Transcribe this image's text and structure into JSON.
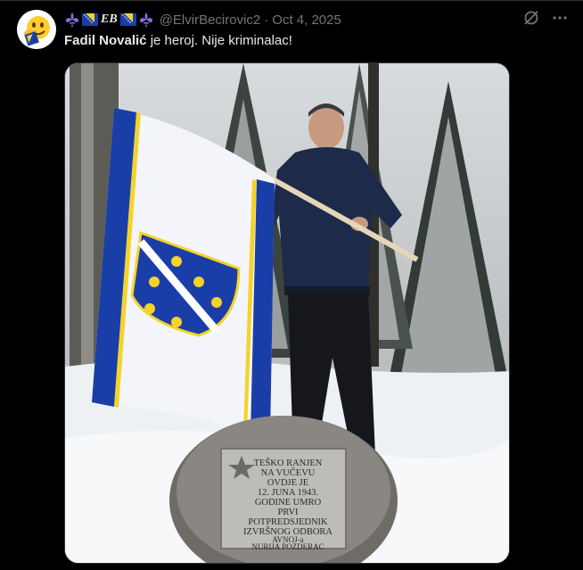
{
  "author": {
    "handle": "@ElvirBecirovic2",
    "separator": "·",
    "date": "Oct 4, 2025",
    "avatar_icon": "yellow-face-emoji-with-bosnian-flag",
    "name_icons": [
      "fleur-de-lis-icon",
      "bosnian-flag-icon",
      "eb-monogram",
      "bosnian-flag-icon",
      "fleur-de-lis-icon"
    ],
    "name_monogram": "EB"
  },
  "post": {
    "bold_name": "Fadil Novalić",
    "rest_text": " je heroj. Nije kriminalac!"
  },
  "actions": {
    "grok_icon": "grok-icon",
    "more_icon": "more-options-icon"
  },
  "media": {
    "plaque_lines": [
      "TEŠKO RANJEN",
      "NA VUČEVU",
      "OVDJE JE",
      "12. JUNA 1943.",
      "GODINE UMRO",
      "PRVI",
      "POTPREDSJEDNIK",
      "IZVRŠNOG ODBORA",
      "AVNOJ-a",
      "NURIJA POZDERAC"
    ]
  },
  "colors": {
    "background": "#000000",
    "text": "#e7e9ea",
    "muted": "#71767b",
    "flag_blue": "#1a3ea8",
    "flag_yellow": "#f4d32a"
  }
}
